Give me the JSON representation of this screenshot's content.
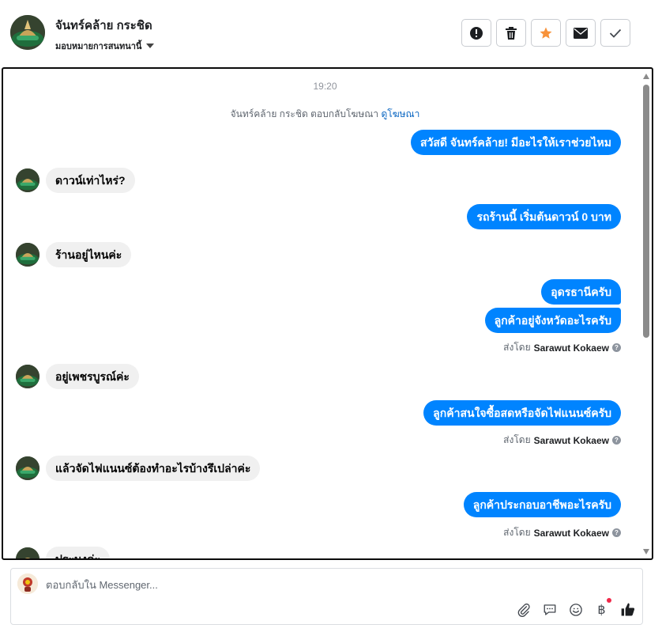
{
  "header": {
    "contact_name": "จันทร์คล้าย กระชิด",
    "assign_label": "มอบหมายการสนทนานี้",
    "actions": [
      {
        "icon": "alert-icon"
      },
      {
        "icon": "trash-icon"
      },
      {
        "icon": "star-icon",
        "color": "#f7923a"
      },
      {
        "icon": "mail-icon"
      },
      {
        "icon": "check-icon"
      }
    ]
  },
  "thread": {
    "timestamp": "19:20",
    "ad_note": "จันทร์คล้าย กระชิด ตอบกลับโฆษณา",
    "ad_link": "ดูโฆษณา",
    "messages": [
      {
        "dir": "out",
        "text": "สวัสดี จันทร์คล้าย! มีอะไรให้เราช่วยไหม"
      },
      {
        "dir": "in",
        "text": "ดาวน์เท่าไหร่?"
      },
      {
        "dir": "out",
        "text": "รถร้านนี้ เริ่มต้นดาวน์ 0 บาท"
      },
      {
        "dir": "in",
        "text": "ร้านอยู่ไหนค่ะ"
      },
      {
        "dir": "out",
        "text": "อุดรธานีครับ"
      },
      {
        "dir": "out",
        "text": "ลูกค้าอยู่จังหวัดอะไรครับ"
      },
      {
        "dir": "in",
        "text": "อยู่เพชรบูรณ์ค่ะ"
      },
      {
        "dir": "out",
        "text": "ลูกค้าสนใจซื้อสดหรือจัดไฟแนนซ์ครับ"
      },
      {
        "dir": "in",
        "text": "แล้วจัดไฟแนนซ์ต้องทำอะไรบ้างรึเปล่าค่ะ"
      },
      {
        "dir": "out",
        "text": "ลูกค้าประกอบอาชีพอะไรครับ"
      },
      {
        "dir": "in",
        "text": "ประมงค่ะ"
      }
    ],
    "sent_by_prefix": "ส่งโดย",
    "sent_by_name": "Sarawut Kokaew"
  },
  "composer": {
    "placeholder": "ตอบกลับใน Messenger..."
  },
  "colors": {
    "outgoing_bubble": "#0084ff",
    "incoming_bubble": "#f0f0f0",
    "link": "#0a66c2"
  }
}
